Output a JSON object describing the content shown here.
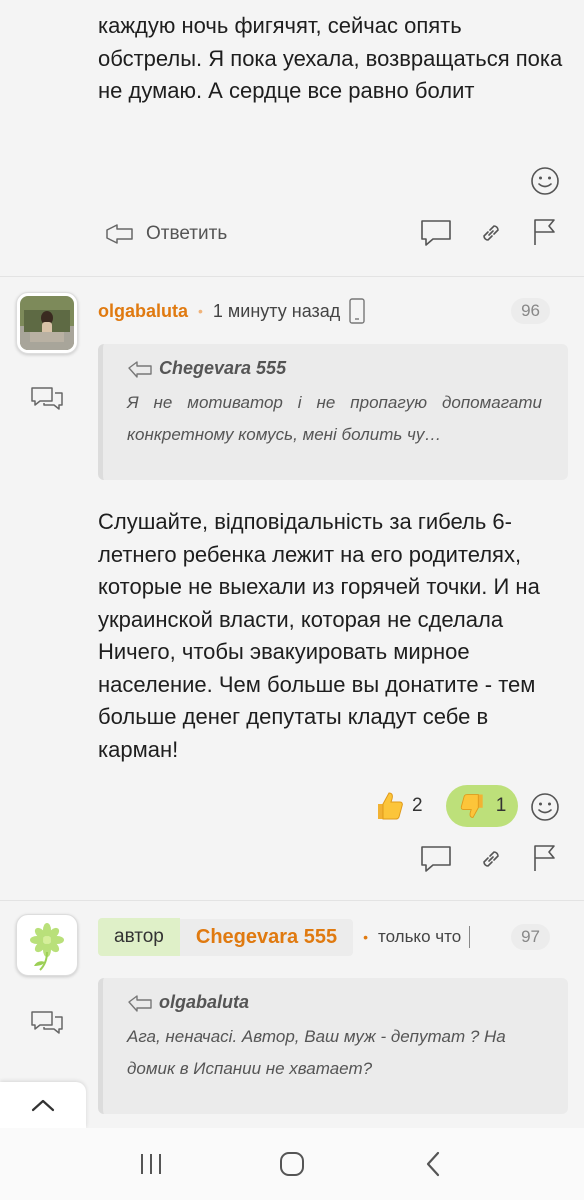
{
  "comment1": {
    "text": "каждую ночь фигячят, сейчас опять обстрелы. Я пока уехала, возвращаться пока не думаю. А сердце все равно болит",
    "reply_label": "Ответить"
  },
  "comment2": {
    "username": "olgabaluta",
    "time": "1 минуту назад",
    "number": "96",
    "quote_author": "Chegevara 555",
    "quote_text": "Я не мотиватор і не пропагую допомагати конкретному комусь, мені болить чу…",
    "text": "Слушайте, відповідальність за гибель 6-летнего ребенка лежит на его родителях, которые не выехали из горячей точки. И на украинской власти, которая не сделала Ничего, чтобы эвакуировать мирное население. Чем больше вы донатите - тем больше денег депутаты кладут себе в карман!",
    "likes": "2",
    "dislikes": "1"
  },
  "comment3": {
    "author_tag": "автор",
    "username": "Chegevara 555",
    "time": "только что",
    "number": "97",
    "quote_author": "olgabaluta",
    "quote_text": "Ага, неначасі. Автор, Ваш муж - депутат ? На домик в Испании не хватает?"
  },
  "colors": {
    "username": "#e07a10",
    "dislike_active": "#bde07a",
    "author_tag_bg": "#dff0c8"
  }
}
